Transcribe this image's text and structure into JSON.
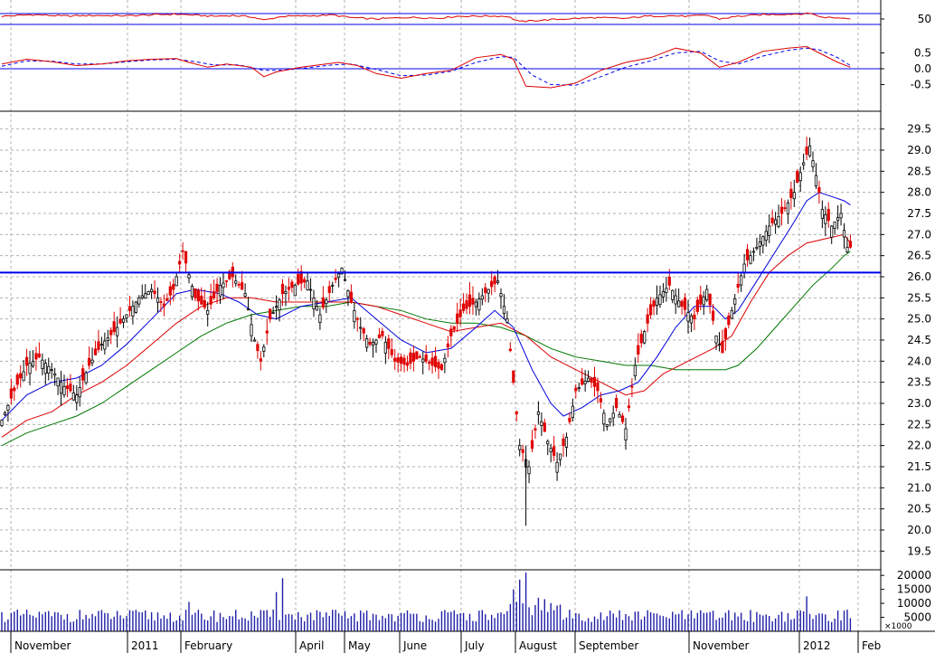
{
  "chart_data": {
    "type": "candlestick",
    "colors": {
      "up": "#000000",
      "down": "#e00000",
      "ma_short": "#0000dd",
      "ma_mid": "#dd0000",
      "ma_long": "#007700",
      "support_line": "#0000ee",
      "volume": "#1f1fa8",
      "grid": "#b0b0b0",
      "frame": "#000000"
    },
    "x_axis": {
      "months": [
        "November",
        "2011",
        "February",
        "April",
        "May",
        "June",
        "July",
        "August",
        "September",
        "November",
        "2012",
        "Feb"
      ]
    },
    "price_panel": {
      "yticks": [
        "29.5",
        "29.0",
        "28.5",
        "28.0",
        "27.5",
        "27.0",
        "26.5",
        "26.0",
        "25.5",
        "25.0",
        "24.5",
        "24.0",
        "23.5",
        "23.0",
        "22.5",
        "22.0",
        "21.5",
        "21.0",
        "20.5",
        "20.0",
        "19.5"
      ],
      "ylim": [
        19.1,
        29.9
      ],
      "support_level": 26.1,
      "close_path": [
        [
          0,
          22.6
        ],
        [
          2,
          23.3
        ],
        [
          4,
          23.9
        ],
        [
          6,
          24.1
        ],
        [
          8,
          23.8
        ],
        [
          10,
          23.4
        ],
        [
          12,
          23.2
        ],
        [
          14,
          23.9
        ],
        [
          16,
          24.4
        ],
        [
          18,
          24.7
        ],
        [
          20,
          25.1
        ],
        [
          22,
          25.5
        ],
        [
          24,
          25.7
        ],
        [
          26,
          25.3
        ],
        [
          27.5,
          25.7
        ],
        [
          29,
          26.6
        ],
        [
          31,
          25.5
        ],
        [
          33,
          25.2
        ],
        [
          35,
          25.8
        ],
        [
          37,
          26.0
        ],
        [
          39,
          25.6
        ],
        [
          40.5,
          24.5
        ],
        [
          41.5,
          24.0
        ],
        [
          43,
          25.0
        ],
        [
          45,
          25.6
        ],
        [
          47,
          25.8
        ],
        [
          49,
          25.9
        ],
        [
          51,
          25.1
        ],
        [
          53,
          25.8
        ],
        [
          54.5,
          26.2
        ],
        [
          56,
          25.4
        ],
        [
          57.5,
          24.8
        ],
        [
          59,
          24.4
        ],
        [
          61,
          24.6
        ],
        [
          63,
          24.0
        ],
        [
          65,
          23.9
        ],
        [
          67,
          24.1
        ],
        [
          69,
          23.9
        ],
        [
          70.5,
          23.8
        ],
        [
          72,
          24.6
        ],
        [
          74,
          25.2
        ],
        [
          76,
          25.4
        ],
        [
          78,
          25.7
        ],
        [
          79.5,
          25.9
        ],
        [
          81,
          25.0
        ],
        [
          82,
          23.5
        ],
        [
          83,
          22.0
        ],
        [
          84.5,
          21.5
        ],
        [
          86,
          22.8
        ],
        [
          87.5,
          22.1
        ],
        [
          89,
          21.6
        ],
        [
          90.5,
          22.2
        ],
        [
          92,
          23.3
        ],
        [
          94,
          23.6
        ],
        [
          95.5,
          23.3
        ],
        [
          97,
          22.5
        ],
        [
          98.5,
          22.9
        ],
        [
          100,
          22.4
        ],
        [
          101.5,
          23.9
        ],
        [
          103,
          24.7
        ],
        [
          105,
          25.5
        ],
        [
          107,
          25.8
        ],
        [
          109,
          25.3
        ],
        [
          111,
          25.0
        ],
        [
          113,
          25.7
        ],
        [
          114.5,
          24.6
        ],
        [
          115.5,
          24.2
        ],
        [
          117,
          25.2
        ],
        [
          119,
          26.3
        ],
        [
          121,
          26.7
        ],
        [
          123,
          27.2
        ],
        [
          125,
          27.5
        ],
        [
          127,
          28.0
        ],
        [
          128.5,
          28.7
        ],
        [
          129.5,
          29.1
        ],
        [
          130.5,
          28.4
        ],
        [
          131.5,
          27.6
        ],
        [
          133,
          27.2
        ],
        [
          134.5,
          27.5
        ],
        [
          135.5,
          26.7
        ]
      ],
      "ma_short_path": [
        [
          0,
          22.6
        ],
        [
          4,
          23.2
        ],
        [
          8,
          23.5
        ],
        [
          12,
          23.6
        ],
        [
          16,
          23.9
        ],
        [
          20,
          24.4
        ],
        [
          24,
          25.0
        ],
        [
          28,
          25.6
        ],
        [
          31,
          25.7
        ],
        [
          35,
          25.6
        ],
        [
          38,
          25.4
        ],
        [
          41,
          25.1
        ],
        [
          44,
          25.0
        ],
        [
          48,
          25.3
        ],
        [
          52,
          25.4
        ],
        [
          56,
          25.5
        ],
        [
          60,
          25.0
        ],
        [
          64,
          24.5
        ],
        [
          68,
          24.2
        ],
        [
          72,
          24.3
        ],
        [
          76,
          24.8
        ],
        [
          79,
          25.2
        ],
        [
          82,
          24.8
        ],
        [
          85,
          23.8
        ],
        [
          88,
          23.0
        ],
        [
          90,
          22.7
        ],
        [
          93,
          22.9
        ],
        [
          96,
          23.2
        ],
        [
          99,
          23.3
        ],
        [
          102,
          23.5
        ],
        [
          105,
          24.1
        ],
        [
          108,
          24.8
        ],
        [
          111,
          25.3
        ],
        [
          114,
          25.3
        ],
        [
          116,
          25.0
        ],
        [
          118,
          25.2
        ],
        [
          121,
          25.9
        ],
        [
          124,
          26.6
        ],
        [
          127,
          27.3
        ],
        [
          129,
          27.8
        ],
        [
          131,
          28.0
        ],
        [
          133,
          27.9
        ],
        [
          135,
          27.8
        ],
        [
          136,
          27.7
        ]
      ],
      "ma_mid_path": [
        [
          0,
          22.2
        ],
        [
          4,
          22.6
        ],
        [
          8,
          22.8
        ],
        [
          12,
          23.2
        ],
        [
          16,
          23.5
        ],
        [
          20,
          23.9
        ],
        [
          24,
          24.4
        ],
        [
          28,
          24.9
        ],
        [
          32,
          25.3
        ],
        [
          36,
          25.5
        ],
        [
          40,
          25.5
        ],
        [
          44,
          25.4
        ],
        [
          48,
          25.4
        ],
        [
          52,
          25.4
        ],
        [
          56,
          25.4
        ],
        [
          60,
          25.3
        ],
        [
          64,
          25.1
        ],
        [
          68,
          24.9
        ],
        [
          72,
          24.7
        ],
        [
          76,
          24.8
        ],
        [
          80,
          24.9
        ],
        [
          84,
          24.6
        ],
        [
          88,
          24.1
        ],
        [
          92,
          23.8
        ],
        [
          96,
          23.5
        ],
        [
          100,
          23.2
        ],
        [
          103,
          23.3
        ],
        [
          106,
          23.7
        ],
        [
          110,
          24.0
        ],
        [
          114,
          24.3
        ],
        [
          117,
          24.6
        ],
        [
          120,
          25.4
        ],
        [
          123,
          26.1
        ],
        [
          126,
          26.5
        ],
        [
          129,
          26.8
        ],
        [
          132,
          26.9
        ],
        [
          135,
          27.0
        ],
        [
          136,
          26.8
        ]
      ],
      "ma_long_path": [
        [
          0,
          22.0
        ],
        [
          4,
          22.3
        ],
        [
          8,
          22.5
        ],
        [
          12,
          22.7
        ],
        [
          16,
          23.0
        ],
        [
          20,
          23.4
        ],
        [
          24,
          23.8
        ],
        [
          28,
          24.2
        ],
        [
          32,
          24.6
        ],
        [
          36,
          24.9
        ],
        [
          40,
          25.1
        ],
        [
          44,
          25.2
        ],
        [
          48,
          25.3
        ],
        [
          52,
          25.3
        ],
        [
          56,
          25.4
        ],
        [
          60,
          25.3
        ],
        [
          64,
          25.2
        ],
        [
          68,
          25.0
        ],
        [
          72,
          24.9
        ],
        [
          76,
          24.9
        ],
        [
          80,
          24.8
        ],
        [
          84,
          24.6
        ],
        [
          88,
          24.3
        ],
        [
          92,
          24.1
        ],
        [
          96,
          24.0
        ],
        [
          100,
          23.9
        ],
        [
          104,
          23.9
        ],
        [
          108,
          23.8
        ],
        [
          112,
          23.8
        ],
        [
          116,
          23.8
        ],
        [
          118,
          23.9
        ],
        [
          121,
          24.3
        ],
        [
          124,
          24.8
        ],
        [
          127,
          25.3
        ],
        [
          130,
          25.8
        ],
        [
          133,
          26.2
        ],
        [
          135,
          26.5
        ],
        [
          136,
          26.6
        ]
      ]
    },
    "rsi_panel": {
      "yticks": [
        "50"
      ],
      "ylim": [
        0,
        100
      ],
      "upper_line": 70,
      "lower_line": 30,
      "path": [
        [
          0,
          60
        ],
        [
          5,
          66
        ],
        [
          10,
          61
        ],
        [
          15,
          63
        ],
        [
          20,
          62
        ],
        [
          25,
          66
        ],
        [
          28,
          68
        ],
        [
          31,
          64
        ],
        [
          34,
          60
        ],
        [
          37,
          63
        ],
        [
          40,
          58
        ],
        [
          42,
          46
        ],
        [
          45,
          60
        ],
        [
          50,
          62
        ],
        [
          53,
          65
        ],
        [
          56,
          55
        ],
        [
          60,
          50
        ],
        [
          65,
          56
        ],
        [
          70,
          53
        ],
        [
          73,
          60
        ],
        [
          78,
          61
        ],
        [
          81,
          60
        ],
        [
          83,
          40
        ],
        [
          86,
          45
        ],
        [
          90,
          50
        ],
        [
          95,
          55
        ],
        [
          100,
          52
        ],
        [
          103,
          60
        ],
        [
          107,
          62
        ],
        [
          110,
          60
        ],
        [
          113,
          64
        ],
        [
          115,
          50
        ],
        [
          118,
          60
        ],
        [
          122,
          66
        ],
        [
          126,
          68
        ],
        [
          130,
          70
        ],
        [
          131,
          58
        ],
        [
          133,
          55
        ],
        [
          136,
          53
        ]
      ]
    },
    "macd_panel": {
      "yticks": [
        "0.5",
        "0.0",
        "-0.5"
      ],
      "ylim": [
        -0.8,
        0.8
      ],
      "macd_path": [
        [
          0,
          0.15
        ],
        [
          4,
          0.3
        ],
        [
          8,
          0.22
        ],
        [
          12,
          0.1
        ],
        [
          16,
          0.15
        ],
        [
          20,
          0.25
        ],
        [
          24,
          0.3
        ],
        [
          28,
          0.32
        ],
        [
          30,
          0.2
        ],
        [
          33,
          0.05
        ],
        [
          36,
          0.15
        ],
        [
          40,
          0.05
        ],
        [
          42,
          -0.25
        ],
        [
          44,
          -0.1
        ],
        [
          48,
          0.05
        ],
        [
          52,
          0.15
        ],
        [
          54,
          0.2
        ],
        [
          57,
          0.1
        ],
        [
          60,
          -0.15
        ],
        [
          64,
          -0.3
        ],
        [
          68,
          -0.15
        ],
        [
          72,
          -0.05
        ],
        [
          76,
          0.35
        ],
        [
          80,
          0.45
        ],
        [
          82,
          0.3
        ],
        [
          84,
          -0.55
        ],
        [
          88,
          -0.6
        ],
        [
          92,
          -0.45
        ],
        [
          96,
          -0.05
        ],
        [
          100,
          0.2
        ],
        [
          104,
          0.35
        ],
        [
          108,
          0.65
        ],
        [
          112,
          0.5
        ],
        [
          115,
          0.05
        ],
        [
          118,
          0.2
        ],
        [
          122,
          0.55
        ],
        [
          126,
          0.65
        ],
        [
          129,
          0.7
        ],
        [
          131,
          0.5
        ],
        [
          134,
          0.2
        ],
        [
          136,
          0.05
        ]
      ],
      "signal_path": [
        [
          0,
          0.08
        ],
        [
          4,
          0.25
        ],
        [
          8,
          0.24
        ],
        [
          12,
          0.15
        ],
        [
          16,
          0.15
        ],
        [
          20,
          0.22
        ],
        [
          24,
          0.28
        ],
        [
          28,
          0.3
        ],
        [
          31,
          0.22
        ],
        [
          34,
          0.12
        ],
        [
          38,
          0.12
        ],
        [
          42,
          -0.05
        ],
        [
          45,
          -0.05
        ],
        [
          49,
          0.03
        ],
        [
          53,
          0.12
        ],
        [
          56,
          0.15
        ],
        [
          60,
          -0.02
        ],
        [
          64,
          -0.22
        ],
        [
          68,
          -0.2
        ],
        [
          72,
          -0.08
        ],
        [
          76,
          0.2
        ],
        [
          80,
          0.38
        ],
        [
          82,
          0.36
        ],
        [
          85,
          -0.2
        ],
        [
          88,
          -0.5
        ],
        [
          92,
          -0.52
        ],
        [
          96,
          -0.25
        ],
        [
          100,
          0.05
        ],
        [
          104,
          0.25
        ],
        [
          108,
          0.5
        ],
        [
          112,
          0.55
        ],
        [
          115,
          0.25
        ],
        [
          118,
          0.15
        ],
        [
          122,
          0.4
        ],
        [
          126,
          0.58
        ],
        [
          129,
          0.65
        ],
        [
          131,
          0.6
        ],
        [
          134,
          0.35
        ],
        [
          136,
          0.1
        ]
      ]
    },
    "volume_panel": {
      "yticks": [
        "20000",
        "15000",
        "10000",
        "5000"
      ],
      "ylim": [
        0,
        22000
      ],
      "unit": "×1000",
      "base_level": 6000,
      "spikes": [
        [
          30,
          10500
        ],
        [
          44,
          14000
        ],
        [
          45,
          19000
        ],
        [
          82,
          15000
        ],
        [
          83,
          18500
        ],
        [
          84,
          21000
        ],
        [
          86,
          12000
        ],
        [
          87,
          11500
        ],
        [
          129,
          12500
        ]
      ]
    }
  }
}
